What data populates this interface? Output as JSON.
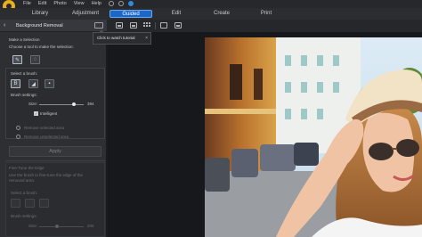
{
  "menu": {
    "items": [
      "File",
      "Edit",
      "Photo",
      "View",
      "Help"
    ]
  },
  "tabs": [
    {
      "label": "Library",
      "active": false
    },
    {
      "label": "Adjustment",
      "active": false
    },
    {
      "label": "Guided",
      "active": true
    },
    {
      "label": "Edit",
      "active": false
    },
    {
      "label": "Create",
      "active": false
    },
    {
      "label": "Print",
      "active": false
    }
  ],
  "panel": {
    "back_icon": "‹",
    "title": "Background Removal",
    "make_selection": "Make a Selection",
    "choose_tool": "Choose a tool to make the selection:",
    "select_brush": "Select a brush:",
    "brush_settings": "Brush settings:",
    "size_label": "Size:",
    "size_value": "394",
    "size_fraction": 0.78,
    "intelligent_label": "Intelligent",
    "remove_selected": "Remove selected area",
    "remove_unselected": "Remove unselected area",
    "apply_label": "Apply",
    "fine_tune_title": "Fine-Tune the Edge",
    "fine_tune_desc": "Use the brush to fine-tune the edge of the removed area.",
    "select_brush_2": "Select a brush:",
    "brush_settings_2": "Brush settings:",
    "size_label_2": "Size:",
    "size_value_2": "200",
    "size_fraction_2": 0.4
  },
  "tooltip": {
    "text": "Click to watch tutorial",
    "close": "×"
  },
  "colors": {
    "accent": "#1a67c7",
    "panel_bg": "#2d2f33",
    "canvas_bg": "#17181b"
  },
  "icons": {
    "logo": "app-logo-icon",
    "toolbar": [
      "image-view-icon",
      "compare-view-icon",
      "grid-view-icon",
      "fit-screen-icon",
      "zoom-dropdown-icon"
    ]
  }
}
